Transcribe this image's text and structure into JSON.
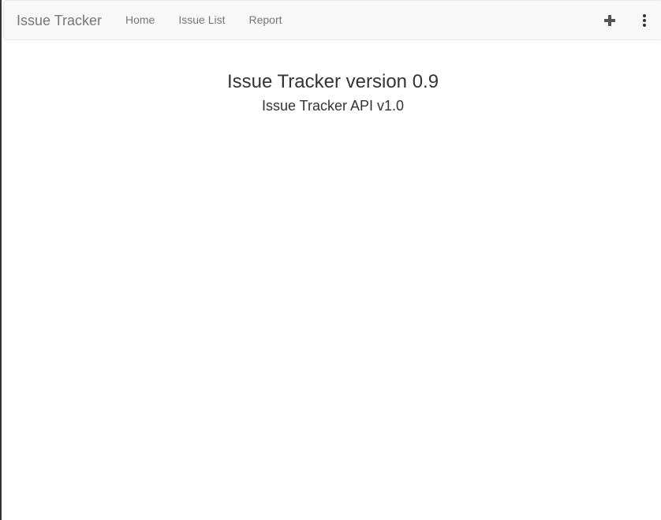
{
  "navbar": {
    "brand": "Issue Tracker",
    "links": [
      {
        "label": "Home"
      },
      {
        "label": "Issue List"
      },
      {
        "label": "Report"
      }
    ],
    "icons": {
      "add": "plus-icon",
      "menu": "vertical-ellipsis-icon"
    }
  },
  "main": {
    "title": "Issue Tracker version 0.9",
    "subtitle": "Issue Tracker API v1.0"
  },
  "colors": {
    "navbar_bg": "#f8f8f8",
    "navbar_border": "#e7e7e7",
    "nav_text": "#777777",
    "body_text": "#333333",
    "icon": "#555555"
  }
}
